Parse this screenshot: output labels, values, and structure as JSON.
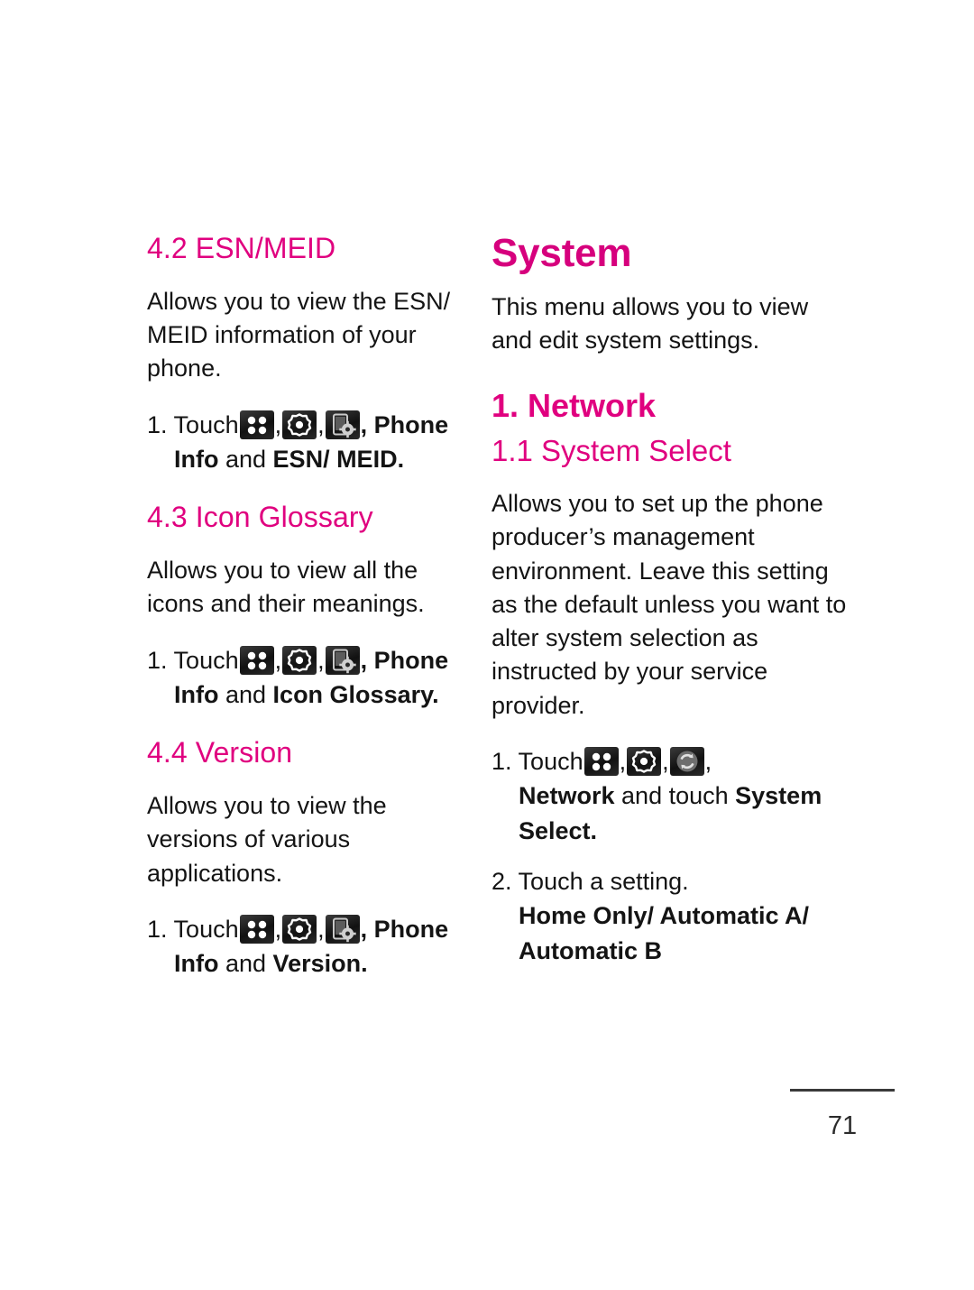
{
  "document": {
    "page_number": "71",
    "accent_color": "#e0007f",
    "chapter_color": "#d6007d",
    "text_color": "#141414"
  },
  "left_column": {
    "sections": [
      {
        "heading": "4.2 ESN/MEID",
        "body": "Allows you to view the ESN/ MEID information of your phone.",
        "step_number": "1.",
        "step_lead": "Touch",
        "icons": [
          "grid-menu-icon",
          "settings-gear-icon",
          "phone-settings-icon"
        ],
        "step_after_icons": ", Phone",
        "step_line2_bold_a": "Info",
        "step_line2_regular": " and ",
        "step_line2_bold_b": "ESN/ MEID."
      },
      {
        "heading": "4.3 Icon Glossary",
        "body": "Allows you to view all the icons and their meanings.",
        "step_number": "1.",
        "step_lead": "Touch",
        "icons": [
          "grid-menu-icon",
          "settings-gear-icon",
          "phone-settings-icon"
        ],
        "step_after_icons": ", Phone",
        "step_line2_bold_a": "Info",
        "step_line2_regular": " and ",
        "step_line2_bold_b": "Icon Glossary."
      },
      {
        "heading": "4.4 Version",
        "body": "Allows you to view the versions of various applications.",
        "step_number": "1.",
        "step_lead": "Touch",
        "icons": [
          "grid-menu-icon",
          "settings-gear-icon",
          "phone-settings-icon"
        ],
        "step_after_icons": ", Phone",
        "step_line2_bold_a": "Info",
        "step_line2_regular": " and ",
        "step_line2_bold_b": "Version."
      }
    ]
  },
  "right_column": {
    "chapter_title": "System",
    "chapter_intro": "This menu allows you to view and edit system settings.",
    "section_heading": "1. Network",
    "sub_heading": "1.1 System Select",
    "sub_body": "Allows you to set up the phone producer’s management environment. Leave this setting as the default unless you want to alter system selection as instructed by your service provider.",
    "step1_number": "1.",
    "step1_lead": "Touch",
    "step1_icons": [
      "grid-menu-icon",
      "settings-gear-icon",
      "network-sync-icon"
    ],
    "step1_after_icons": ",",
    "step1_line2_bold_a": "Network",
    "step1_line2_regular": " and touch ",
    "step1_line2_bold_b": "System Select.",
    "step2_number": "2.",
    "step2_text": "Touch a setting.",
    "step2_options": "Home Only/ Automatic A/ Automatic B"
  }
}
